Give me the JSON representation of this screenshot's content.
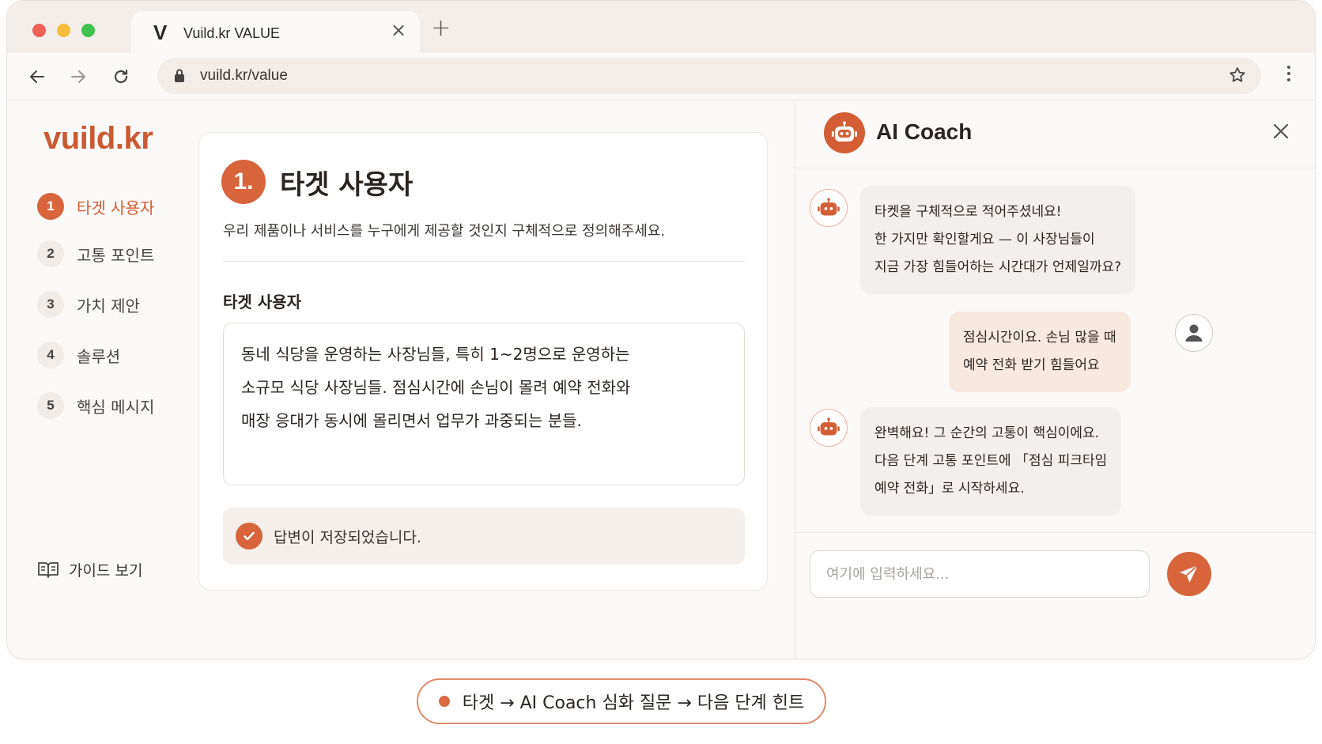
{
  "browser": {
    "tab": {
      "logo": "V",
      "title": "Vuild.kr VALUE",
      "close": "×"
    },
    "new_tab": "+",
    "url": "vuild.kr/value"
  },
  "sidebar": {
    "brand": "vuild.kr",
    "steps": [
      {
        "num": "1",
        "label": "타겟 사용자",
        "active": true
      },
      {
        "num": "2",
        "label": "고통 포인트",
        "active": false
      },
      {
        "num": "3",
        "label": "가치 제안",
        "active": false
      },
      {
        "num": "4",
        "label": "솔루션",
        "active": false
      },
      {
        "num": "5",
        "label": "핵심 메시지",
        "active": false
      }
    ],
    "guide_label": "가이드 보기"
  },
  "card": {
    "number": "1.",
    "title": "타겟 사용자",
    "description": "우리 제품이나 서비스를 누구에게 제공할 것인지 구체적으로 정의해주세요.",
    "field_label": "타겟 사용자",
    "answer_lines": [
      "동네 식당을 운영하는 사장님들, 특히 1~2명으로 운영하는",
      "소규모 식당 사장님들. 점심시간에 손님이 몰려 예약 전화와",
      "매장 응대가 동시에 몰리면서 업무가 과중되는 분들."
    ],
    "saved_text": "답변이 저장되었습니다."
  },
  "coach": {
    "title": "AI Coach",
    "messages": [
      {
        "role": "bot",
        "lines": [
          "타켓을 구체적으로 적어주셨네요!",
          "한 가지만 확인할게요 — 이 사장님들이",
          "지금 가장 힘들어하는 시간대가 언제일까요?"
        ]
      },
      {
        "role": "user",
        "lines": [
          "점심시간이요. 손님 많을 때",
          "예약 전화 받기 힘들어요"
        ]
      },
      {
        "role": "bot",
        "lines": [
          "완벽해요! 그 순간의 고통이 핵심이에요.",
          "다음 단계 고통 포인트에 「점심 피크타임",
          "예약 전화」로 시작하세요."
        ]
      }
    ],
    "input_placeholder": "여기에 입력하세요..."
  },
  "flow": {
    "text": "타겟 → AI Coach 심화 질문 → 다음 단계 힌트"
  },
  "colors": {
    "accent": "#d8643c",
    "brand": "#c95a33"
  }
}
